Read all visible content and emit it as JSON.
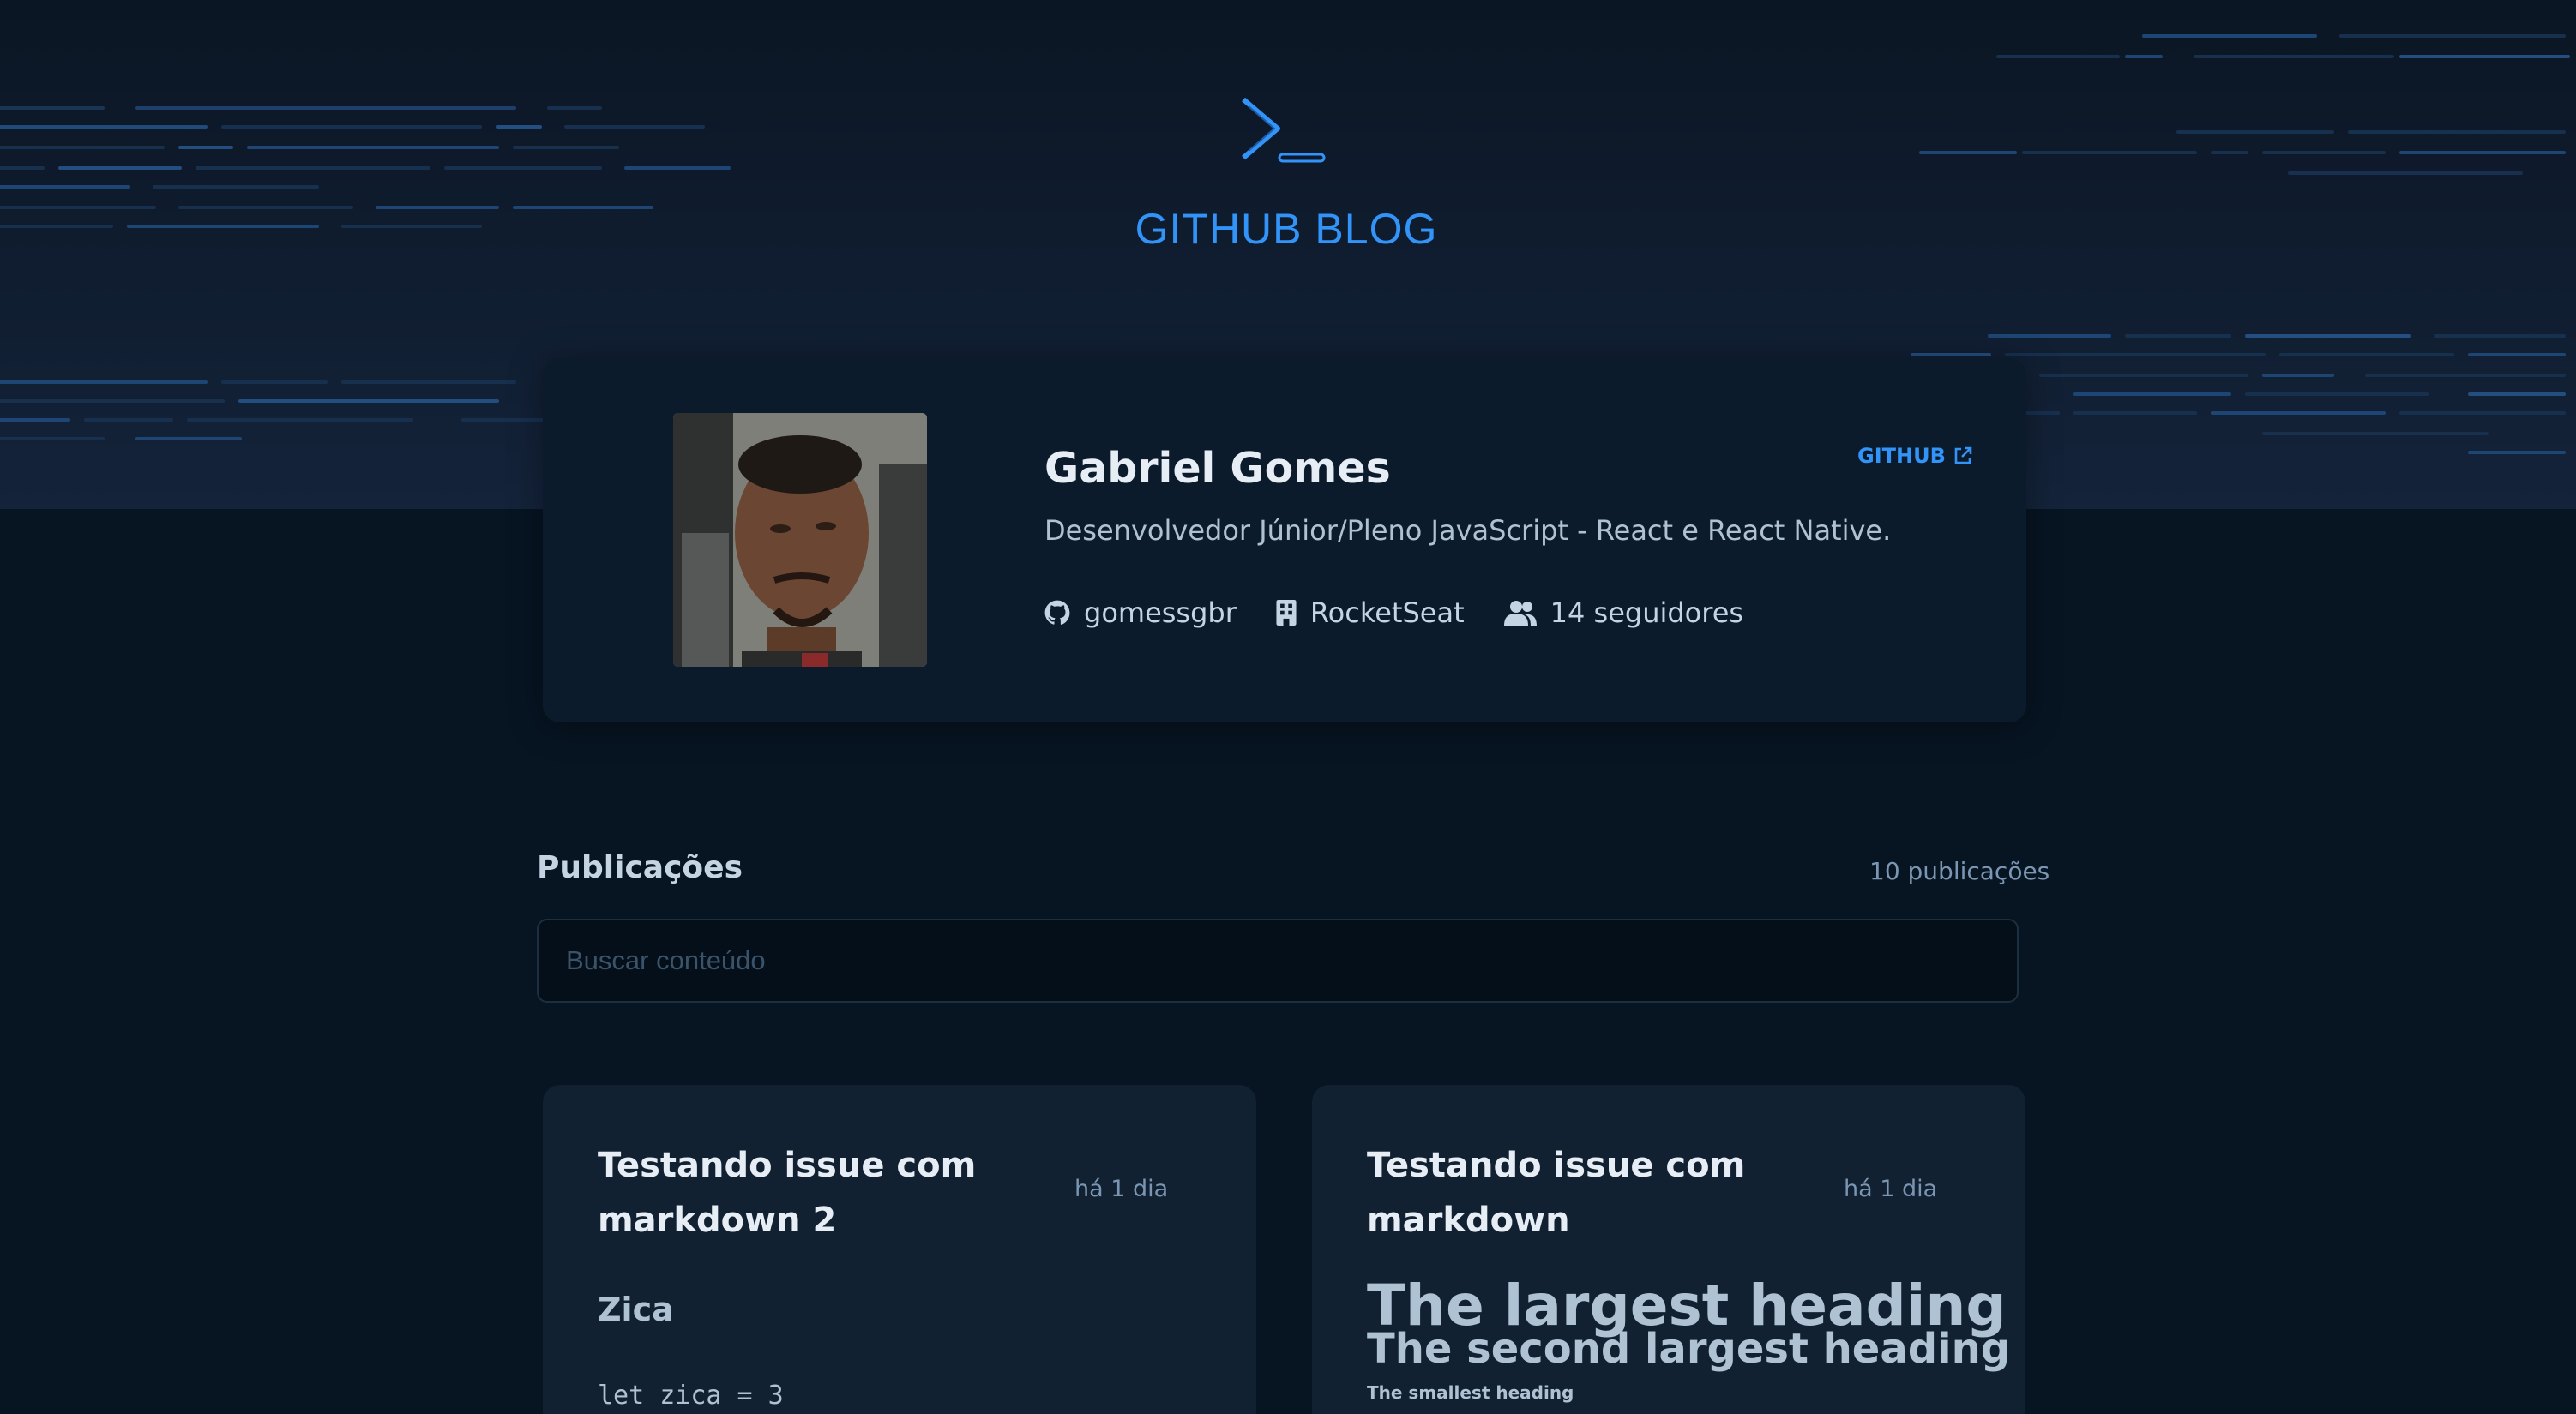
{
  "header": {
    "logo_icon": "terminal-prompt-icon",
    "title": "GITHUB BLOG",
    "accent_color": "#3294f8"
  },
  "profile": {
    "name": "Gabriel Gomes",
    "github_link_label": "GITHUB",
    "github_link_icon": "external-link-icon",
    "bio": "Desenvolvedor Júnior/Pleno JavaScript - React e React Native.",
    "username": "gomessgbr",
    "company": "RocketSeat",
    "followers": "14 seguidores"
  },
  "publications": {
    "title": "Publicações",
    "count": "10 publicações",
    "search_placeholder": "Buscar conteúdo"
  },
  "posts": [
    {
      "title": "Testando issue com markdown 2",
      "date": "há 1 dia",
      "preview_heading": "Zica",
      "preview_code": "let zica = 3"
    },
    {
      "title": "Testando issue com markdown",
      "date": "há 1 dia",
      "preview_h1": "The largest heading",
      "preview_h2": "The second largest heading",
      "preview_h6": "The smallest heading"
    }
  ]
}
